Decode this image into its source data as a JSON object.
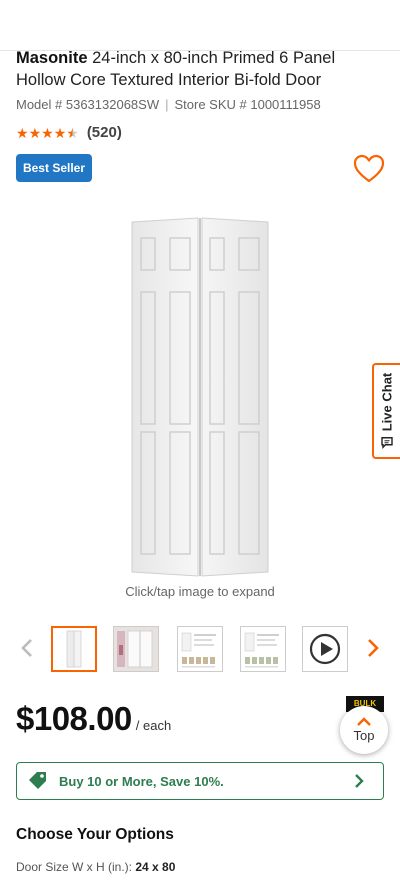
{
  "product": {
    "brand": "Masonite",
    "title_rest": " 24-inch x 80-inch Primed 6 Panel Hollow Core Textured Interior Bi-fold Door",
    "model_label": "Model # 5363132068SW",
    "sku_label": "Store SKU # 1000111958",
    "separator": "|",
    "rating": 4.5,
    "review_count": "(520)",
    "badge": "Best Seller",
    "image_caption": "Click/tap image to expand"
  },
  "live_chat": {
    "label": "Live Chat",
    "icon": "chat-bubble-icon"
  },
  "thumbnails": [
    {
      "name": "thumb-door-main",
      "selected": true
    },
    {
      "name": "thumb-door-room",
      "selected": false
    },
    {
      "name": "thumb-spec-sheet-1",
      "selected": false
    },
    {
      "name": "thumb-spec-sheet-2",
      "selected": false
    },
    {
      "name": "thumb-video",
      "selected": false
    }
  ],
  "pricing": {
    "amount": "$108.00",
    "unit": "/ each",
    "bulk_tag": "BULK"
  },
  "top_button": {
    "label": "Top"
  },
  "promo": {
    "label": "Buy 10 or More, Save 10%."
  },
  "options": {
    "heading": "Choose Your Options",
    "door_size_label": "Door Size W x H (in.):",
    "door_size_value": "24 x 80"
  },
  "colors": {
    "accent": "#f96302",
    "badge_blue": "#2277c4",
    "promo_green": "#2e7d4f"
  }
}
